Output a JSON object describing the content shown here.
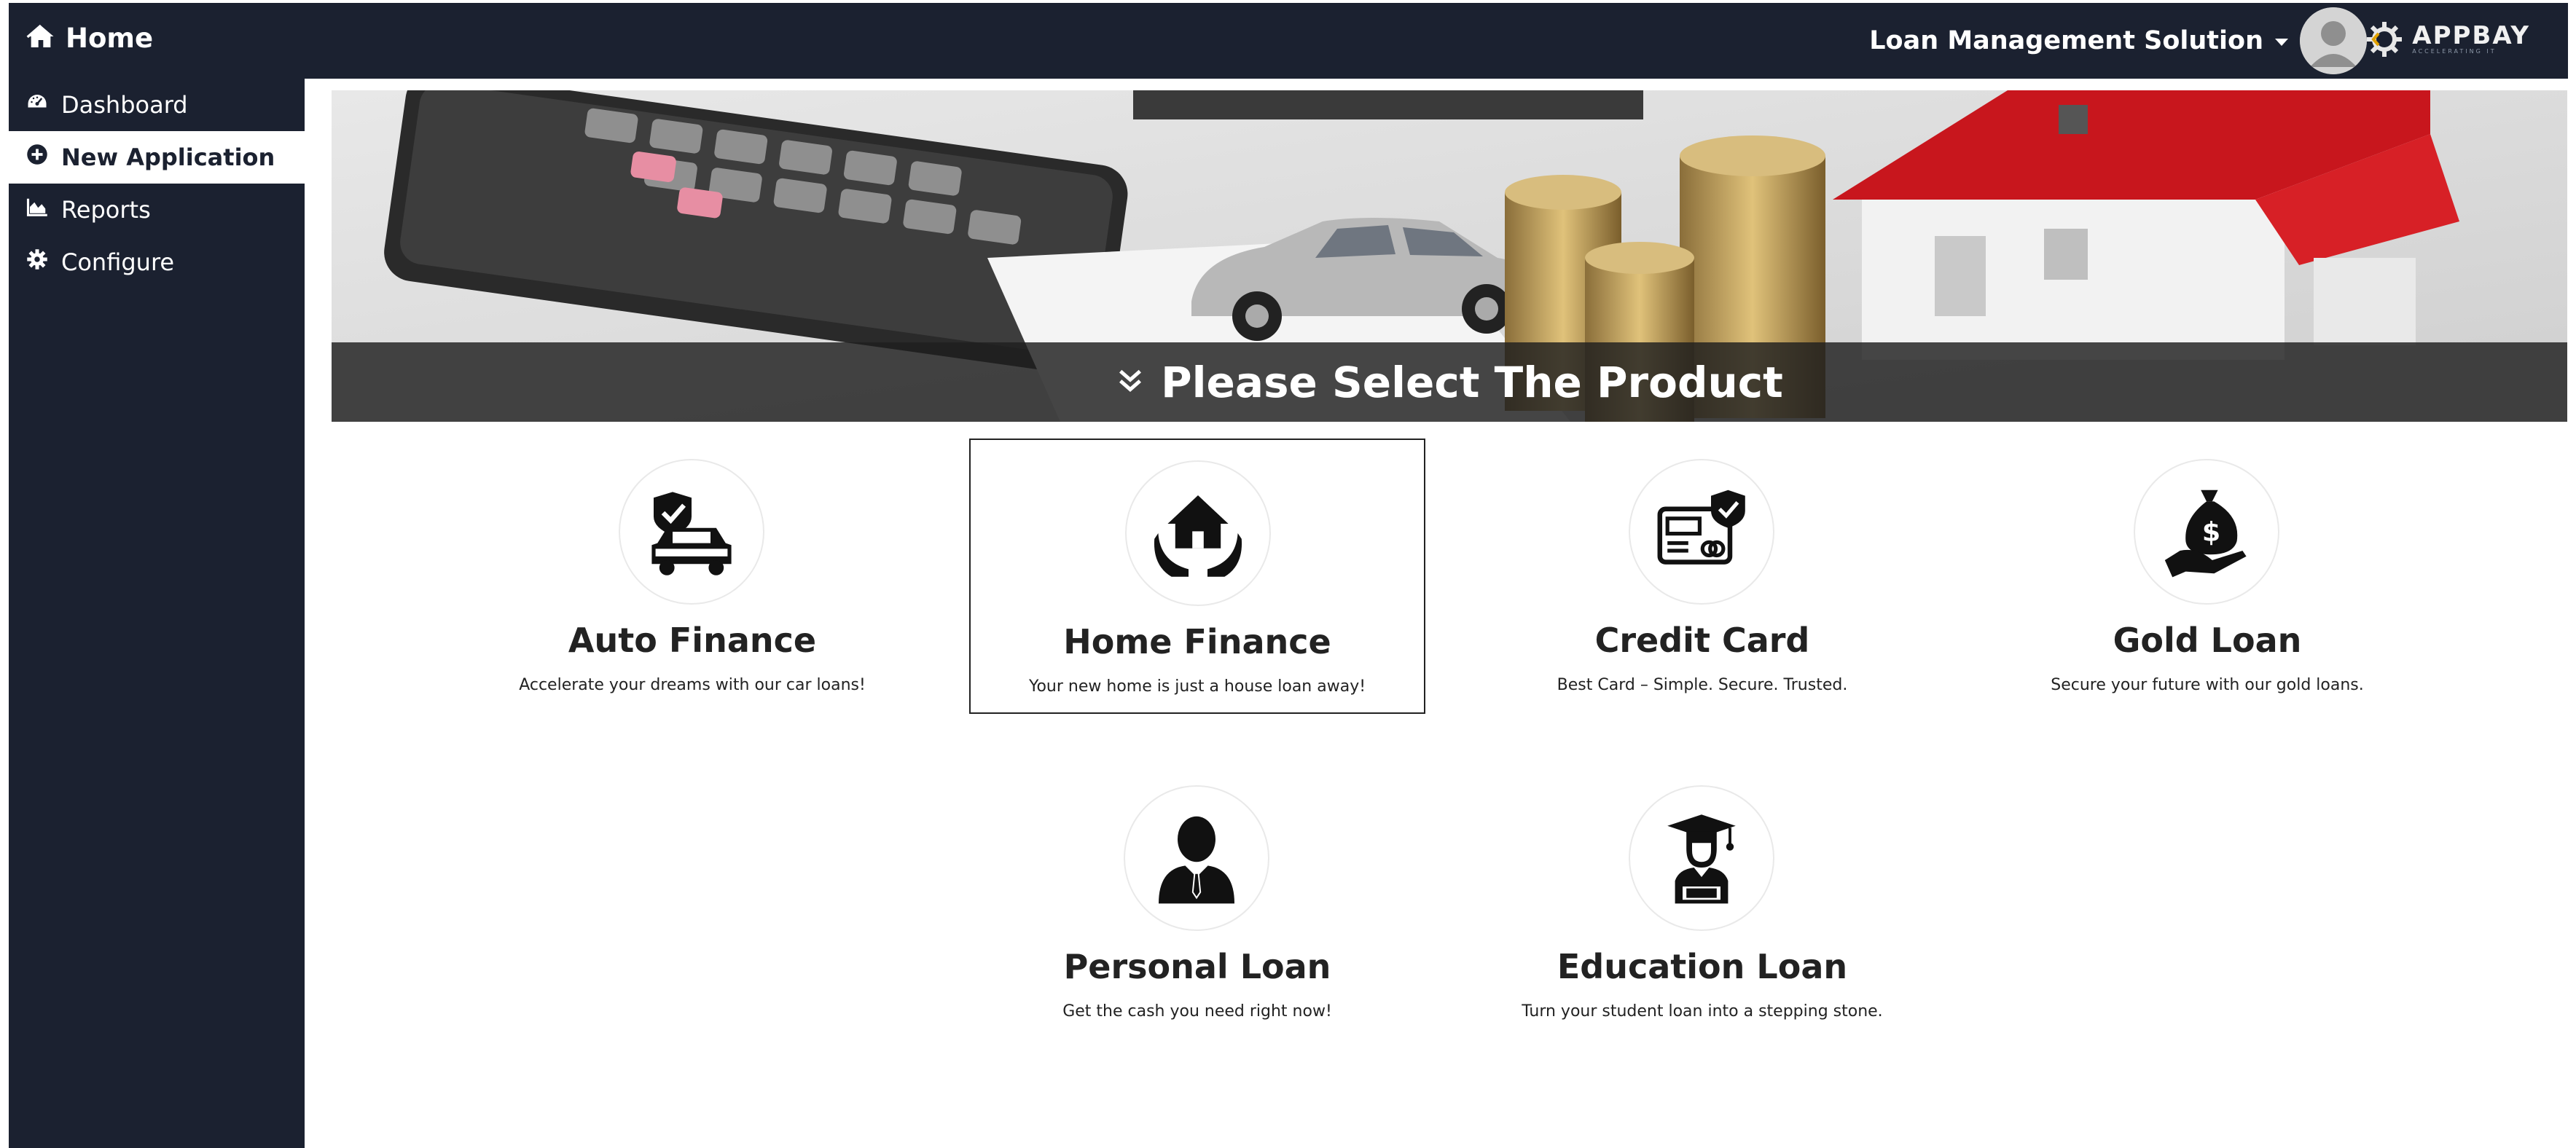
{
  "header": {
    "brand_label": "Home",
    "brand_icon": "home-icon",
    "solution_label": "Loan Management Solution",
    "logo_text": "APPBAY",
    "logo_subtext": "ACCELERATING IT"
  },
  "sidebar": {
    "items": [
      {
        "label": "Dashboard",
        "icon": "dashboard-icon"
      },
      {
        "label": "New Application",
        "icon": "plus-circle-icon",
        "active": true
      },
      {
        "label": "Reports",
        "icon": "area-chart-icon"
      },
      {
        "label": "Configure",
        "icon": "gear-icon"
      }
    ]
  },
  "banner": {
    "title": "Please Select The Product",
    "icon": "double-chevron-down-icon"
  },
  "products": [
    {
      "title": "Auto Finance",
      "description": "Accelerate your dreams with our car loans!",
      "icon": "car-shield-icon"
    },
    {
      "title": "Home Finance",
      "description": "Your new home is just a house loan away!",
      "icon": "house-hands-icon",
      "selected": true
    },
    {
      "title": "Credit Card",
      "description": "Best Card – Simple. Secure. Trusted.",
      "icon": "credit-card-shield-icon"
    },
    {
      "title": "Gold Loan",
      "description": "Secure your future with our gold loans.",
      "icon": "money-bag-hand-icon"
    },
    {
      "title": "Personal Loan",
      "description": "Get the cash you need right now!",
      "icon": "businessman-icon"
    },
    {
      "title": "Education Loan",
      "description": "Turn your student loan into a stepping stone.",
      "icon": "graduate-icon"
    }
  ],
  "colors": {
    "navbar_bg": "#1b2130",
    "active_item_bg": "#ffffff",
    "text_dark": "#222222"
  }
}
